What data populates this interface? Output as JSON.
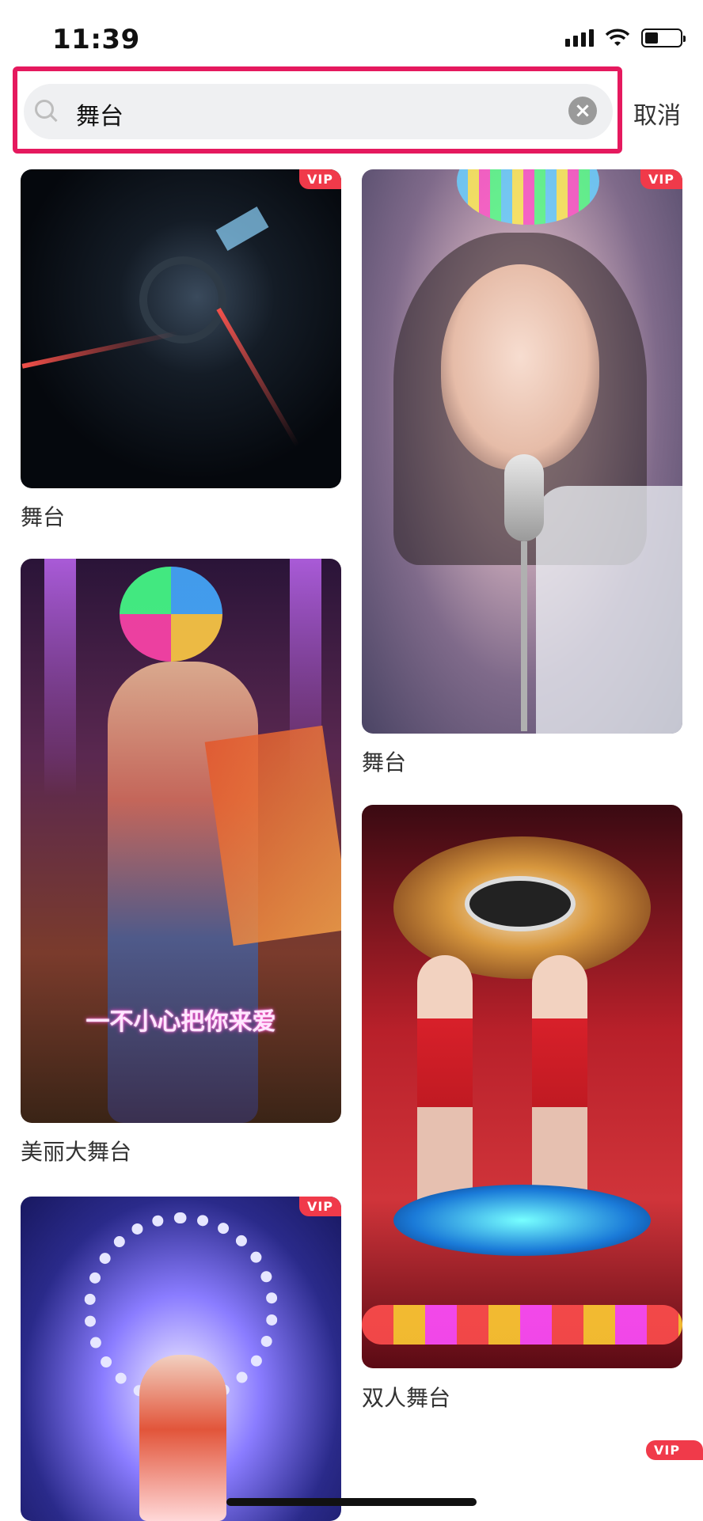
{
  "status_bar": {
    "time": "11:39"
  },
  "search": {
    "query": "舞台",
    "cancel_label": "取消"
  },
  "vip_label": "VIP",
  "results": [
    {
      "caption": "舞台",
      "vip": true
    },
    {
      "caption": "舞台",
      "vip": true
    },
    {
      "caption": "美丽大舞台",
      "vip": false,
      "overlay_text": "一不小心把你来爱"
    },
    {
      "caption": "双人舞台",
      "vip": false
    },
    {
      "caption": "",
      "vip": true
    },
    {
      "caption": "",
      "vip": true
    }
  ],
  "colors": {
    "highlight": "#e5195e",
    "vip_badge": "#f03a4a",
    "search_bg": "#eff0f2"
  }
}
